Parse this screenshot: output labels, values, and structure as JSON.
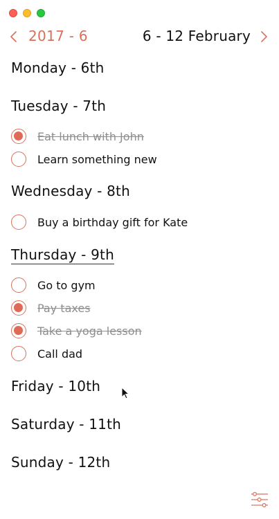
{
  "header": {
    "month_label": "2017 - 6",
    "week_label": "6 - 12 February",
    "prev_icon": "chevron-left-icon",
    "next_icon": "chevron-right-icon"
  },
  "colors": {
    "accent": "#d8705a",
    "checked_fill": "#e06a58",
    "done_text": "#8e8e8e"
  },
  "days": [
    {
      "label": "Monday - 6th",
      "tasks": []
    },
    {
      "label": "Tuesday - 7th",
      "tasks": [
        {
          "text": "Eat lunch with John",
          "done": true
        },
        {
          "text": "Learn something new",
          "done": false
        }
      ]
    },
    {
      "label": "Wednesday - 8th",
      "tasks": [
        {
          "text": "Buy a birthday gift for Kate",
          "done": false
        }
      ]
    },
    {
      "label": "Thursday - 9th",
      "selected": true,
      "tasks": [
        {
          "text": "Go to gym",
          "done": false
        },
        {
          "text": "Pay taxes",
          "done": true
        },
        {
          "text": "Take a yoga lesson",
          "done": true
        },
        {
          "text": "Call dad",
          "done": false
        }
      ]
    },
    {
      "label": "Friday - 10th",
      "tasks": []
    },
    {
      "label": "Saturday - 11th",
      "tasks": []
    },
    {
      "label": "Sunday - 12th",
      "tasks": []
    }
  ],
  "footer": {
    "settings_icon": "sliders-icon"
  }
}
